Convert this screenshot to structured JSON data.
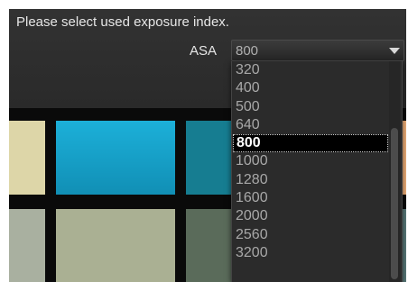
{
  "header": {
    "instruction": "Please select used exposure index."
  },
  "asa": {
    "label": "ASA",
    "selected_value": "800",
    "options": [
      "320",
      "400",
      "500",
      "640",
      "800",
      "1000",
      "1280",
      "1600",
      "2000",
      "2560",
      "3200"
    ]
  },
  "icons": {
    "dropdown": "chevron-down-icon"
  },
  "colors": {
    "panel": "#2d2d2d",
    "selected_option_bg": "#000000",
    "selected_option_text": "#ffffff"
  }
}
